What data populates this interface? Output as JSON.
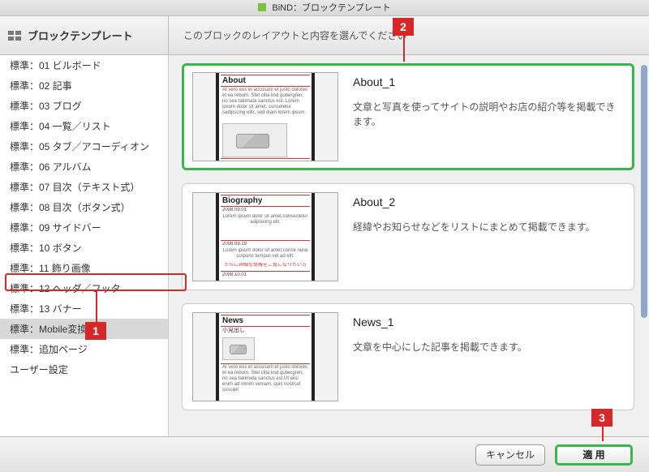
{
  "window": {
    "title": "BiND：ブロックテンプレート"
  },
  "header": {
    "section_title": "ブロックテンプレート",
    "subtitle": "このブロックのレイアウトと内容を選んでください"
  },
  "sidebar": {
    "items": [
      {
        "label": "標準：01 ビルボード"
      },
      {
        "label": "標準：02 記事"
      },
      {
        "label": "標準：03 ブログ"
      },
      {
        "label": "標準：04 一覧／リスト"
      },
      {
        "label": "標準：05 タブ／アコーディオン"
      },
      {
        "label": "標準：06 アルバム"
      },
      {
        "label": "標準：07 目次（テキスト式）"
      },
      {
        "label": "標準：08 目次（ボタン式）"
      },
      {
        "label": "標準：09 サイドバー"
      },
      {
        "label": "標準：10 ボタン"
      },
      {
        "label": "標準：11 飾り画像"
      },
      {
        "label": "標準：12 ヘッダ／フッタ"
      },
      {
        "label": "標準：13 バナー"
      },
      {
        "label": "標準：Mobile変換",
        "selected": true
      },
      {
        "label": "標準：追加ページ"
      },
      {
        "label": "ユーザー設定"
      }
    ]
  },
  "templates": [
    {
      "title": "About_1",
      "desc": "文章と写真を使ってサイトの説明やお店の紹介等を掲載できます。",
      "thumb_title": "About",
      "selected": true
    },
    {
      "title": "About_2",
      "desc": "経緯やお知らせなどをリストにまとめて掲載できます。",
      "thumb_title": "Biography"
    },
    {
      "title": "News_1",
      "desc": "文章を中心にした記事を掲載できます。",
      "thumb_title": "News",
      "thumb_sub": "小見出し"
    }
  ],
  "footer": {
    "cancel": "キャンセル",
    "apply": "適 用"
  },
  "callouts": {
    "n1": "1",
    "n2": "2",
    "n3": "3"
  }
}
